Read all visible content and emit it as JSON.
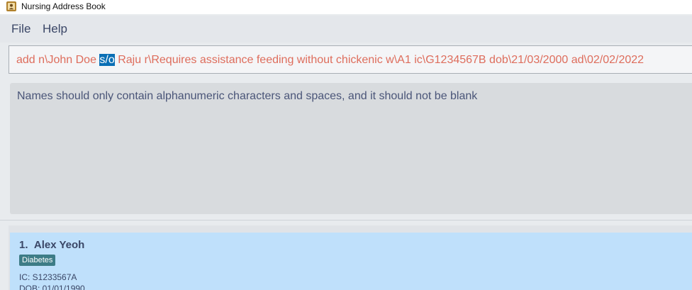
{
  "window": {
    "title": "Nursing Address Book",
    "icon": "address-book-icon"
  },
  "menu": {
    "items": [
      "File",
      "Help"
    ]
  },
  "command": {
    "before": "add n\\John Doe ",
    "selected": "s/o",
    "after": " Raju r\\Requires assistance feeding without chickenic w\\A1 ic\\G1234567B dob\\21/03/2000 ad\\02/02/2022",
    "text_color": "#de6d5c",
    "selection_color": "#0a6fb5"
  },
  "result": {
    "message": "Names should only contain alphanumeric characters and spaces, and it should not be blank"
  },
  "patients": [
    {
      "index": "1.",
      "name": "Alex Yeoh",
      "tags": [
        "Diabetes"
      ],
      "ic": "IC: S1233567A",
      "dob": "DOB: 01/01/1990"
    }
  ]
}
